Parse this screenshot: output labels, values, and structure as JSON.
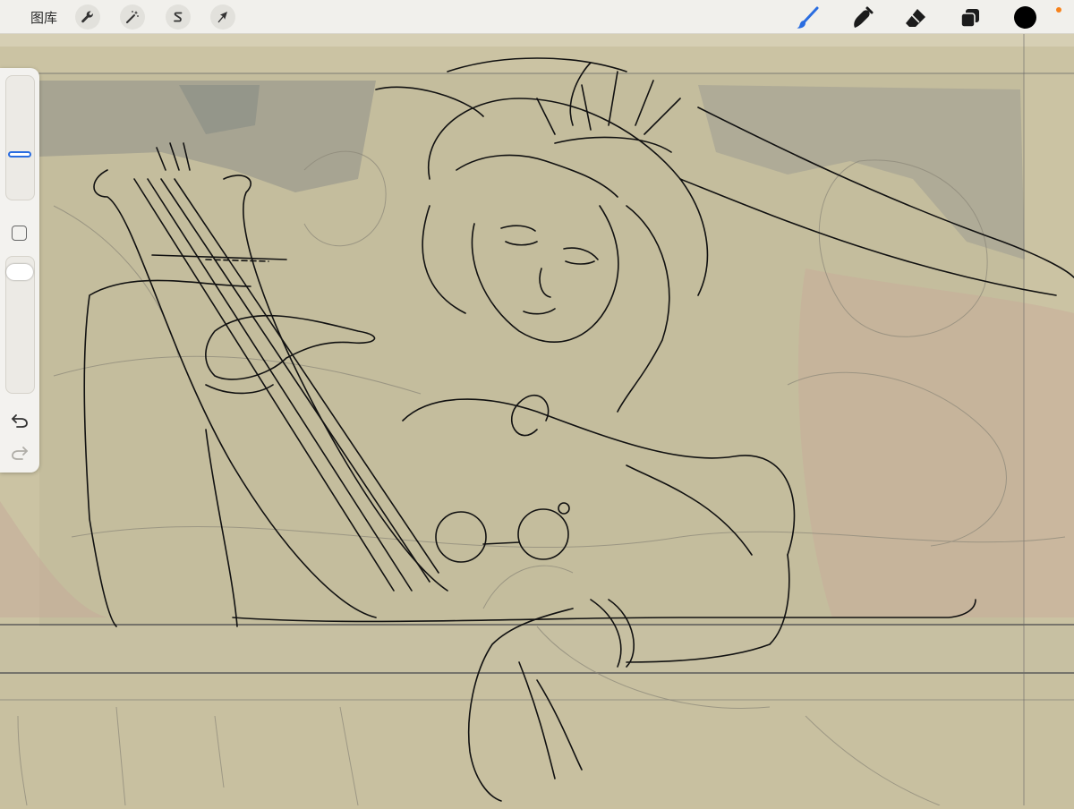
{
  "toolbar": {
    "gallery_label": "图库",
    "left_buttons": [
      "wrench-icon",
      "magic-wand-icon",
      "selection-icon",
      "transform-arrow-icon"
    ],
    "right_tools": [
      "brush-icon",
      "smudge-icon",
      "eraser-icon",
      "layers-icon"
    ],
    "active_tool": "brush-icon",
    "color": "#000000",
    "active_accent": "#2a6de0",
    "status_dot_color": "#f7821b"
  },
  "sidebar": {
    "controls": [
      "brush-size-slider",
      "modify-button",
      "opacity-slider",
      "undo-icon",
      "redo-icon"
    ]
  }
}
